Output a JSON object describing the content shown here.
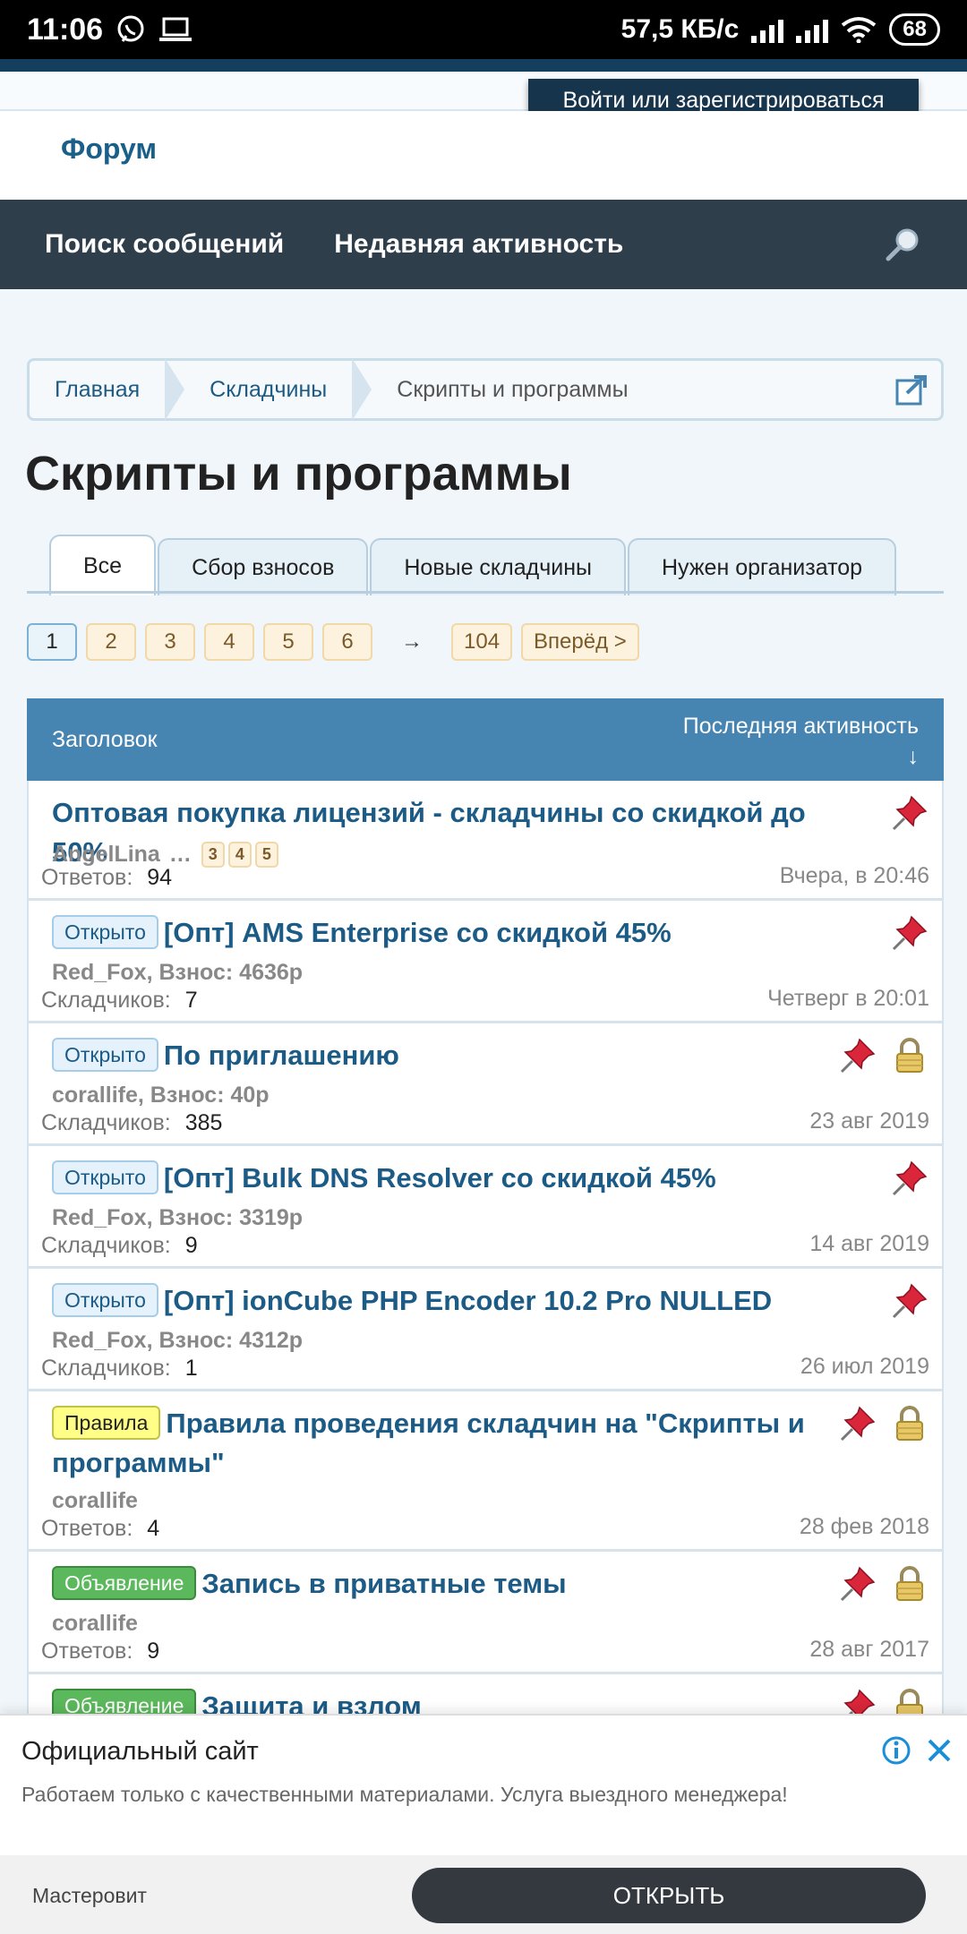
{
  "status_bar": {
    "time": "11:06",
    "speed": "57,5 КБ/с",
    "battery": "68"
  },
  "header": {
    "login_label": "Войти или зарегистрироваться",
    "forum_label": "Форум"
  },
  "nav": {
    "items": [
      "Поиск сообщений",
      "Недавняя активность"
    ]
  },
  "breadcrumb": [
    "Главная",
    "Складчины",
    "Скрипты и программы"
  ],
  "page_title": "Скрипты и программы",
  "tabs": [
    "Все",
    "Сбор взносов",
    "Новые складчины",
    "Нужен организатор"
  ],
  "pager": {
    "pages": [
      "1",
      "2",
      "3",
      "4",
      "5",
      "6"
    ],
    "arrow": "→",
    "last": "104",
    "next": "Вперёд >"
  },
  "table_header": {
    "title": "Заголовок",
    "last_activity": "Последняя активность",
    "sort": "↓"
  },
  "threads": [
    {
      "badge": "",
      "title": "Оптовая покупка лицензий - складчины со скидкой до 50%",
      "meta": "AngelLina",
      "mini_pages": [
        "3",
        "4",
        "5"
      ],
      "stat_label": "Ответов:",
      "stat_value": "94",
      "date": "Вчера, в 20:46",
      "icons": [
        "pin-icon"
      ]
    },
    {
      "badge": "Открыто",
      "title": "[Опт] AMS Enterprise со скидкой 45%",
      "meta": "Red_Fox, Взнос: 4636р",
      "stat_label": "Складчиков:",
      "stat_value": "7",
      "date": "Четверг в 20:01",
      "icons": [
        "pin-icon"
      ]
    },
    {
      "badge": "Открыто",
      "title": "По приглашению",
      "meta": "corallife, Взнос: 40р",
      "stat_label": "Складчиков:",
      "stat_value": "385",
      "date": "23 авг 2019",
      "icons": [
        "pin-icon",
        "lock-icon"
      ]
    },
    {
      "badge": "Открыто",
      "title": "[Опт] Bulk DNS Resolver со скидкой 45%",
      "meta": "Red_Fox, Взнос: 3319р",
      "stat_label": "Складчиков:",
      "stat_value": "9",
      "date": "14 авг 2019",
      "icons": [
        "pin-icon"
      ]
    },
    {
      "badge": "Открыто",
      "title": "[Опт] ionCube PHP Encoder 10.2 Pro NULLED",
      "meta": "Red_Fox, Взнос: 4312р",
      "stat_label": "Складчиков:",
      "stat_value": "1",
      "date": "26 июл 2019",
      "icons": [
        "pin-icon"
      ]
    },
    {
      "badge": "Правила",
      "title": "Правила проведения складчин на \"Скрипты и программы\"",
      "meta": "corallife",
      "stat_label": "Ответов:",
      "stat_value": "4",
      "date": "28 фев 2018",
      "icons": [
        "pin-icon",
        "lock-icon"
      ]
    },
    {
      "badge": "Объявление",
      "title": "Запись в приватные темы",
      "meta": "corallife",
      "stat_label": "Ответов:",
      "stat_value": "9",
      "date": "28 авг 2017",
      "icons": [
        "pin-icon",
        "lock-icon"
      ]
    },
    {
      "badge": "Объявление",
      "title": "Защита и взлом",
      "meta": "",
      "stat_label": "",
      "stat_value": "",
      "date": "",
      "icons": [
        "pin-icon",
        "lock-icon"
      ]
    }
  ],
  "ad": {
    "title": "Официальный сайт",
    "text": "Работаем только с качественными материалами. Услуга выездного менеджера!",
    "brand": "Мастеровит",
    "cta": "ОТКРЫТЬ"
  },
  "colors": {
    "nav_bg": "#2f3e4b",
    "table_header": "#4684b2",
    "link": "#1c5b86",
    "pin": "#d9263a"
  }
}
